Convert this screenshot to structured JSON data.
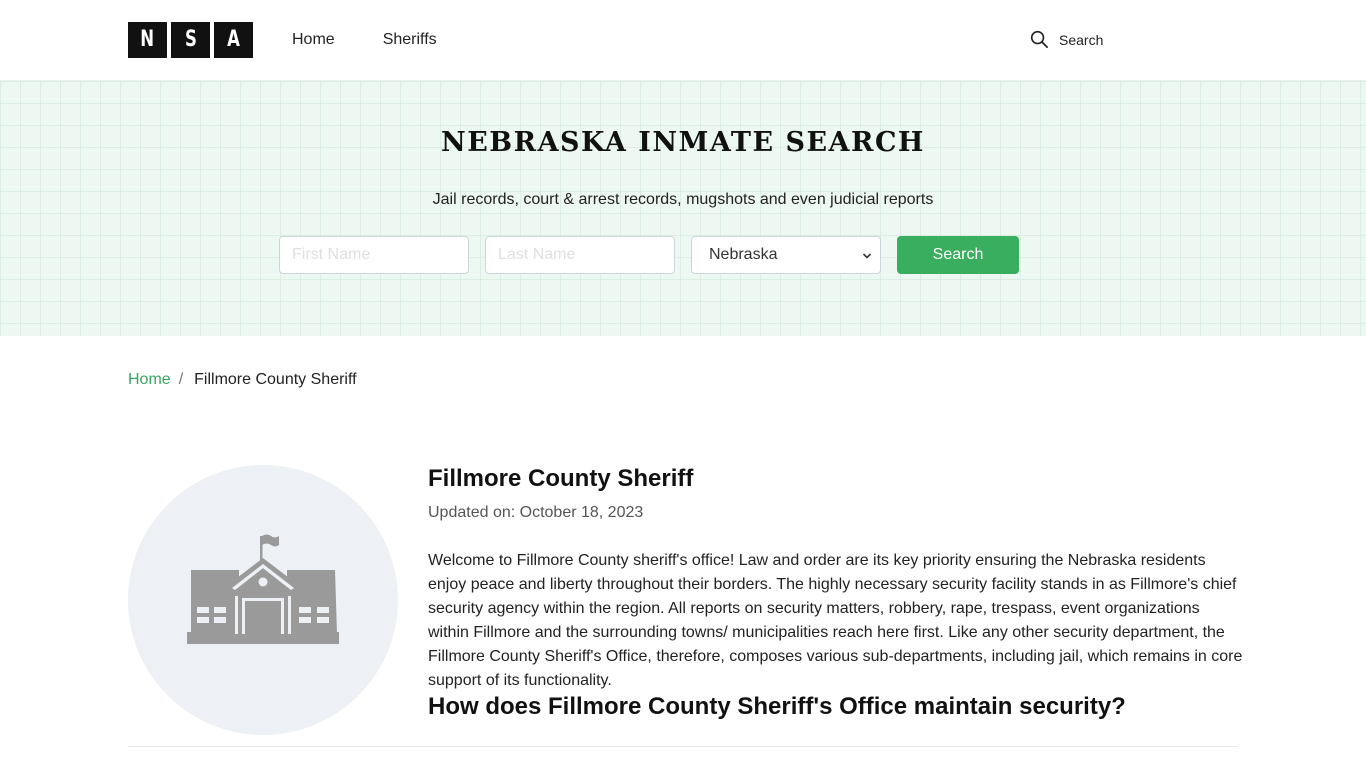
{
  "header": {
    "logo_letters": [
      "N",
      "S",
      "A"
    ],
    "nav": [
      {
        "label": "Home"
      },
      {
        "label": "Sheriffs"
      }
    ],
    "search_label": "Search",
    "search_icon": "magnifier-icon"
  },
  "hero": {
    "title": "NEBRASKA INMATE SEARCH",
    "subtitle": "Jail records, court & arrest records, mugshots and even judicial reports",
    "first_name_placeholder": "First Name",
    "first_name_value": "",
    "last_name_placeholder": "Last Name",
    "last_name_value": "",
    "state_selected": "Nebraska",
    "search_button": "Search",
    "accent_color": "#3aae5f"
  },
  "breadcrumb": {
    "home": "Home",
    "separator": "/",
    "current": "Fillmore County Sheriff"
  },
  "main": {
    "image_icon": "courthouse-building-icon",
    "title": "Fillmore County Sheriff",
    "updated": "Updated on: October 18, 2023",
    "body": "Welcome to Fillmore County sheriff's office! Law and order are its key priority ensuring the Nebraska residents enjoy peace and liberty throughout their borders. The highly necessary security facility stands in as Fillmore's chief security agency within the region. All reports on security matters, robbery, rape, trespass, event organizations within Fillmore and the surrounding towns/ municipalities reach here first. Like any other security department, the Fillmore County Sheriff's Office, therefore, composes various sub-departments, including jail, which remains in core support of its functionality.",
    "subheading": "How does Fillmore County Sheriff's Office maintain security?"
  }
}
